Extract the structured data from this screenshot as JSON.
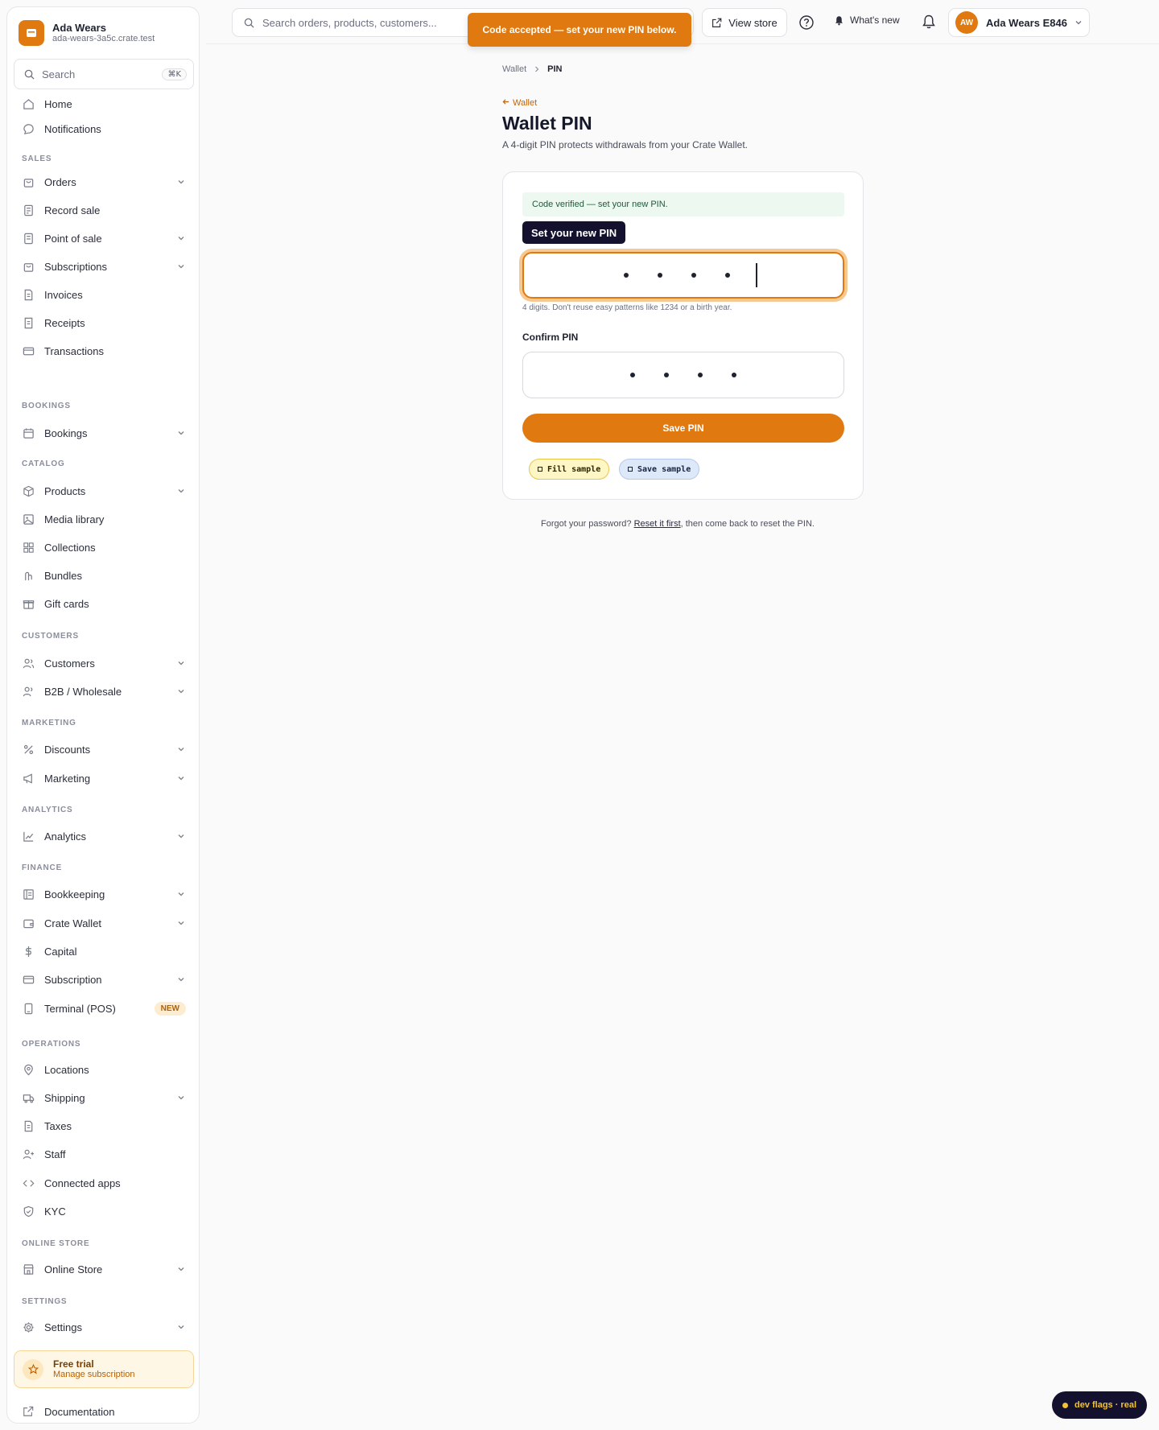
{
  "brand": {
    "name": "Ada Wears",
    "domain": "ada-wears-3a5c.crate.test"
  },
  "sidebar": {
    "search_placeholder": "Search",
    "search_shortcut": "⌘K",
    "home": "Home",
    "notifications": "Notifications",
    "sections": {
      "sales": "SALES",
      "bookings": "BOOKINGS",
      "catalog": "CATALOG",
      "customers": "CUSTOMERS",
      "marketing": "MARKETING",
      "analytics": "ANALYTICS",
      "finance": "FINANCE",
      "operations": "OPERATIONS",
      "online_store": "ONLINE STORE",
      "settings": "SETTINGS"
    },
    "items": {
      "orders": "Orders",
      "record_sale": "Record sale",
      "point_of_sale": "Point of sale",
      "subscriptions": "Subscriptions",
      "invoices": "Invoices",
      "receipts": "Receipts",
      "transactions": "Transactions",
      "bookings": "Bookings",
      "products": "Products",
      "media_library": "Media library",
      "collections": "Collections",
      "bundles": "Bundles",
      "gift_cards": "Gift cards",
      "customers": "Customers",
      "b2b": "B2B / Wholesale",
      "discounts": "Discounts",
      "marketing": "Marketing",
      "analytics": "Analytics",
      "bookkeeping": "Bookkeeping",
      "crate_wallet": "Crate Wallet",
      "capital": "Capital",
      "subscription": "Subscription",
      "terminal": "Terminal (POS)",
      "terminal_badge": "NEW",
      "locations": "Locations",
      "shipping": "Shipping",
      "taxes": "Taxes",
      "staff": "Staff",
      "connected_apps": "Connected apps",
      "kyc": "KYC",
      "online_store": "Online Store",
      "settings": "Settings"
    },
    "trial": {
      "title": "Free trial",
      "subtitle": "Manage subscription"
    },
    "documentation": "Documentation"
  },
  "topbar": {
    "search_placeholder": "Search orders, products, customers...",
    "view_store": "View store",
    "whats_new": "What's new",
    "account_initials": "AW",
    "account_name": "Ada Wears E846"
  },
  "toast": "Code accepted — set your new PIN below.",
  "breadcrumb": {
    "parent": "Wallet",
    "current": "PIN"
  },
  "page": {
    "back": "Wallet",
    "title": "Wallet PIN",
    "subtitle": "A 4-digit PIN protects withdrawals from your Crate Wallet."
  },
  "form": {
    "verified_message": "Code verified — set your new PIN.",
    "new_pin_tooltip": "Set your new PIN",
    "new_pin_digits": 4,
    "hint": "4 digits. Don't reuse easy patterns like 1234 or a birth year.",
    "confirm_label": "Confirm PIN",
    "confirm_pin_digits": 4,
    "save_button": "Save PIN",
    "fill_sample": "Fill sample",
    "save_sample": "Save sample"
  },
  "footer": {
    "prefix": "Forgot your password?",
    "link": "Reset it first",
    "suffix": ", then come back to reset the PIN."
  },
  "dev_flags": "dev flags · real",
  "colors": {
    "accent": "#e07a10",
    "dark": "#14112e",
    "success_bg": "#edf8f1"
  }
}
